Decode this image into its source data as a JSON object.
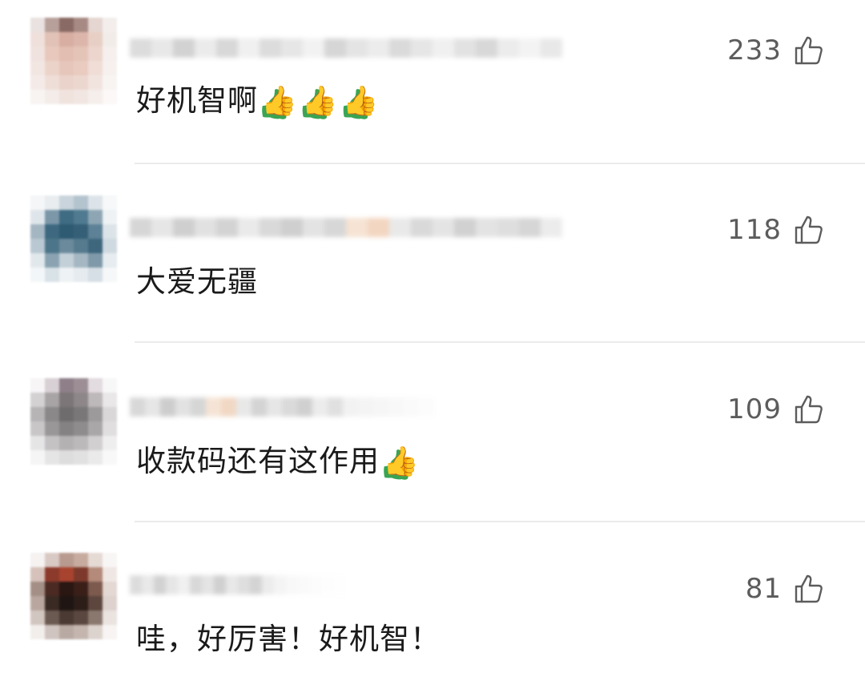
{
  "comments": [
    {
      "text": "好机智啊",
      "thumbs": 3,
      "likes": "233",
      "username_hidden": true
    },
    {
      "text": "大爱无疆",
      "thumbs": 0,
      "likes": "118",
      "username_hidden": true
    },
    {
      "text": "收款码还有这作用",
      "thumbs": 1,
      "likes": "109",
      "username_hidden": true
    },
    {
      "text": "哇，好厉害！好机智！",
      "thumbs": 0,
      "likes": "81",
      "username_hidden": true
    }
  ],
  "icons": {
    "like": "thumbs-up-outline-icon",
    "emoji": "thumbs-up-emoji"
  },
  "colors": {
    "background": "#ffffff",
    "text": "#1a1a1a",
    "like": "#5c5c5c",
    "divider": "#ebebeb"
  }
}
